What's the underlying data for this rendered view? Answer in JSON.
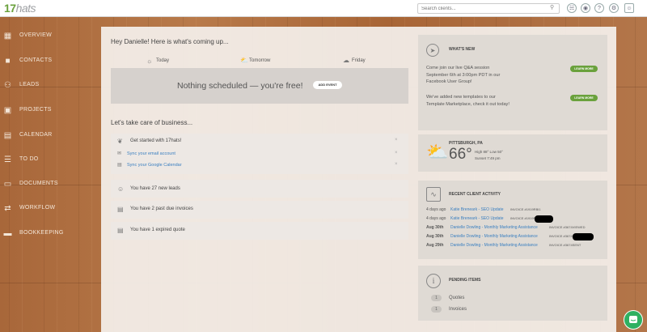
{
  "app": {
    "logo_number": "17",
    "logo_text": "hats"
  },
  "search": {
    "placeholder": "Search clients..."
  },
  "sidebar": {
    "items": [
      {
        "label": "OVERVIEW",
        "icon": "dashboard-icon"
      },
      {
        "label": "CONTACTS",
        "icon": "contacts-icon"
      },
      {
        "label": "LEADS",
        "icon": "leads-icon"
      },
      {
        "label": "PROJECTS",
        "icon": "projects-icon"
      },
      {
        "label": "CALENDAR",
        "icon": "calendar-icon"
      },
      {
        "label": "TO DO",
        "icon": "todo-icon"
      },
      {
        "label": "DOCUMENTS",
        "icon": "documents-icon"
      },
      {
        "label": "WORKFLOW",
        "icon": "workflow-icon"
      },
      {
        "label": "BOOKKEEPING",
        "icon": "bookkeeping-icon"
      }
    ]
  },
  "main": {
    "greeting": "Hey Danielle! Here is what's coming up...",
    "days": [
      "Today",
      "Tomorrow",
      "Friday"
    ],
    "nothing_scheduled": "Nothing scheduled — you're free!",
    "add_event": "ADD EVENT",
    "business_title": "Let's take care of business...",
    "get_started": {
      "title": "Get started with 17hats!",
      "items": [
        "Sync your email account",
        "Sync your Google Calendar"
      ]
    },
    "leads": "You have 27 new leads",
    "invoices": "You have 2 past due invoices",
    "quotes": "You have 1 expired quote"
  },
  "whats_new": {
    "title": "WHAT'S NEW",
    "items": [
      {
        "text": "Come join our live Q&A session September 6th at 3:00pm PDT in our Facebook User Group!",
        "button": "LEARN MORE"
      },
      {
        "text": "We've added new templates to our Template Marketplace, check it out today!",
        "button": "LEARN MORE"
      }
    ]
  },
  "weather": {
    "city": "PITTSBURGH, PA",
    "temp": "66°",
    "high_low": "High 88° Low 50°",
    "sunset": "Sunset 7:49 pm"
  },
  "activity": {
    "title": "RECENT CLIENT ACTIVITY",
    "rows": [
      {
        "when": "4 days ago",
        "link": "Katie Breneark - SEO Update",
        "ref": "INVOICE #1919RBI1"
      },
      {
        "when": "4 days ago",
        "link": "Katie Breneark - SEO Update",
        "ref": "INVOICE #1919RB"
      },
      {
        "when": "Aug 30th",
        "link": "Danielle Dowling - Monthly Marketing Assistance",
        "ref": "INVOICE #3674VIEWED"
      },
      {
        "when": "Aug 30th",
        "link": "Danielle Dowling - Monthly Marketing Assistance",
        "ref": "INVOICE #3674"
      },
      {
        "when": "Aug 29th",
        "link": "Danielle Dowling - Monthly Marketing Assistance",
        "ref": "INVOICE #3674SENT"
      }
    ]
  },
  "pending": {
    "title": "PENDING ITEMS",
    "items": [
      {
        "count": "1",
        "label": "Quotes"
      },
      {
        "count": "1",
        "label": "Invoices"
      }
    ]
  },
  "colors": {
    "accent": "#6aa13c",
    "link": "#3a7fc0",
    "wood": "#b07040"
  }
}
